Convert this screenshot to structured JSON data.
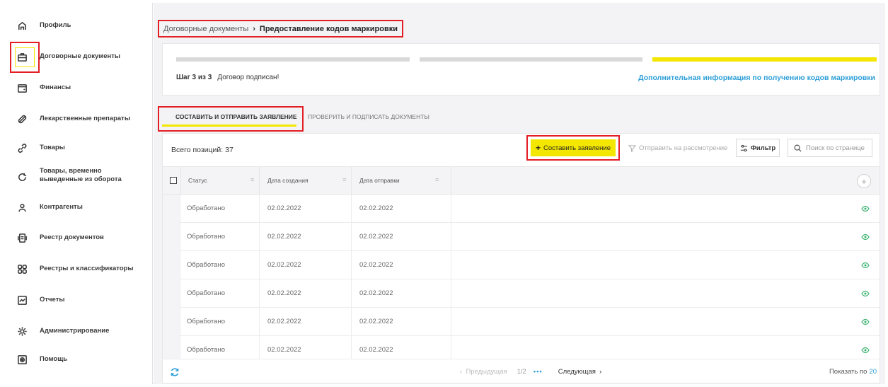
{
  "sidebar": {
    "items": [
      {
        "label": "Профиль",
        "icon": "home-icon"
      },
      {
        "label": "Договорные документы",
        "icon": "briefcase-icon"
      },
      {
        "label": "Финансы",
        "icon": "wallet-icon"
      },
      {
        "label": "Лекарственные препараты",
        "icon": "pill-icon"
      },
      {
        "label": "Товары",
        "icon": "link-icon"
      },
      {
        "label": "Товары, временно выведенные из оборота",
        "icon": "refresh-circle-icon"
      },
      {
        "label": "Контрагенты",
        "icon": "user-icon"
      },
      {
        "label": "Реестр документов",
        "icon": "document-list-icon"
      },
      {
        "label": "Реестры и классификаторы",
        "icon": "grid-icon"
      },
      {
        "label": "Отчеты",
        "icon": "chart-icon"
      },
      {
        "label": "Администрирование",
        "icon": "gear-icon"
      },
      {
        "label": "Помощь",
        "icon": "help-icon"
      }
    ]
  },
  "breadcrumb": {
    "parent": "Договорные документы",
    "separator": "›",
    "current": "Предоставление кодов маркировки"
  },
  "steps": {
    "step_label": "Шаг 3 из 3",
    "status": "Договор подписан!",
    "info_link": "Дополнительная информация по получению кодов маркировки",
    "progress": {
      "completed_color": "#d9d9d9",
      "active_color": "#f3e600"
    }
  },
  "tabs": [
    {
      "label": "СОСТАВИТЬ И ОТПРАВИТЬ ЗАЯВЛЕНИЕ",
      "active": true
    },
    {
      "label": "ПРОВЕРИТЬ И ПОДПИСАТЬ ДОКУМЕНТЫ",
      "active": false
    }
  ],
  "toolbar": {
    "total": "Всего позиций: 37",
    "create_label": "Составить заявление",
    "send_label": "Отправить на рассмотрение",
    "filter_label": "Фильтр",
    "search_placeholder": "Поиск по странице"
  },
  "table": {
    "columns": [
      "Статус",
      "Дата создания",
      "Дата отправки"
    ],
    "rows": [
      [
        "Обработано",
        "02.02.2022",
        "02.02.2022"
      ],
      [
        "Обработано",
        "02.02.2022",
        "02.02.2022"
      ],
      [
        "Обработано",
        "02.02.2022",
        "02.02.2022"
      ],
      [
        "Обработано",
        "02.02.2022",
        "02.02.2022"
      ],
      [
        "Обработано",
        "02.02.2022",
        "02.02.2022"
      ],
      [
        "Обработано",
        "02.02.2022",
        "02.02.2022"
      ]
    ]
  },
  "pagination": {
    "prev": "Предыдущая",
    "page": "1/2",
    "dots": "•••",
    "next": "Следующая",
    "show_label": "Показать по",
    "show_value": "20"
  },
  "colors": {
    "accent_yellow": "#f3e600",
    "highlight_red": "#e31e24",
    "link_blue": "#2f9fd8",
    "eye_green": "#3cb371"
  }
}
